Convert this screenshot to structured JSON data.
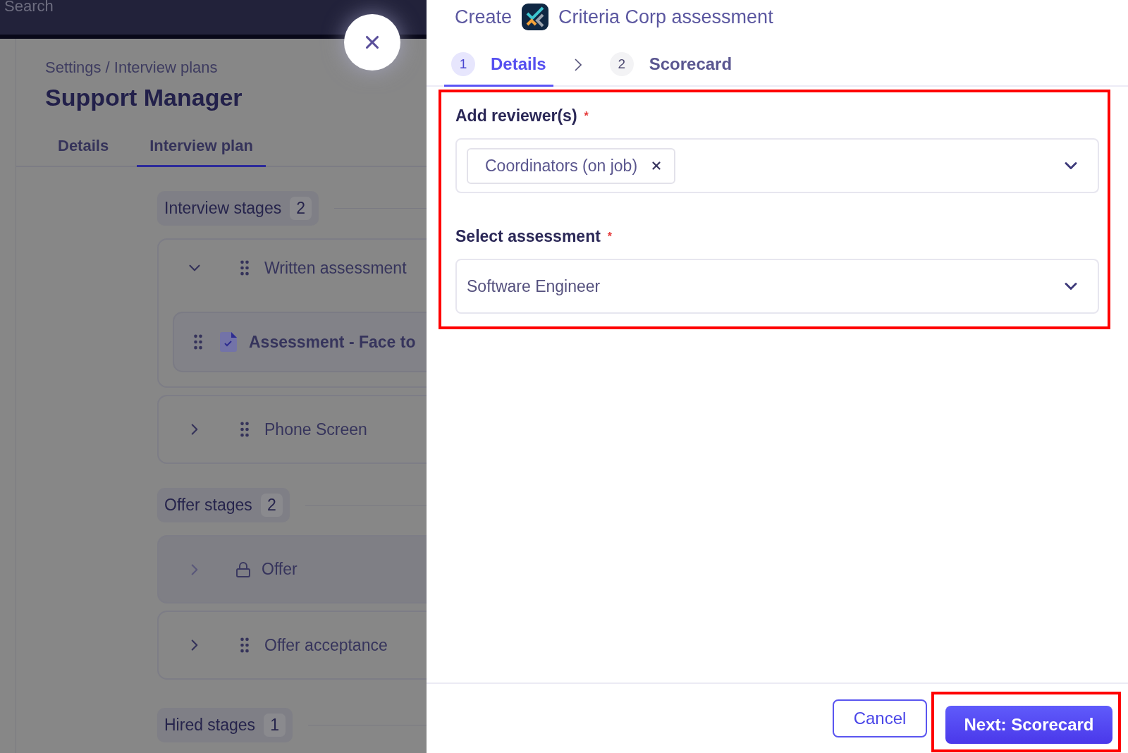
{
  "topbar": {
    "search": "Search"
  },
  "breadcrumb": "Settings / Interview plans",
  "page_title": "Support Manager",
  "page_tabs": [
    {
      "label": "Details",
      "selected": false
    },
    {
      "label": "Interview plan",
      "selected": true
    }
  ],
  "stage_groups": [
    {
      "title": "Interview stages",
      "count": "2",
      "stages": [
        {
          "name": "Written assessment",
          "kind": "drag",
          "expanded": true,
          "children": [
            {
              "name": "Assessment - Face to"
            }
          ]
        },
        {
          "name": "Phone Screen",
          "kind": "drag",
          "expanded": false
        }
      ]
    },
    {
      "title": "Offer stages",
      "count": "2",
      "stages": [
        {
          "name": "Offer",
          "kind": "locked",
          "expanded": false
        },
        {
          "name": "Offer acceptance",
          "kind": "drag",
          "expanded": false
        }
      ]
    },
    {
      "title": "Hired stages",
      "count": "1"
    }
  ],
  "drawer": {
    "title_prefix": "Create",
    "title": "Criteria Corp assessment",
    "steps": [
      {
        "number": "1",
        "label": "Details",
        "selected": true
      },
      {
        "number": "2",
        "label": "Scorecard",
        "selected": false
      }
    ],
    "fields": [
      {
        "label": "Add reviewer(s)",
        "required_mark": "*",
        "kind": "tags",
        "tags": [
          "Coordinators (on job)"
        ]
      },
      {
        "label": "Select assessment",
        "required_mark": "*",
        "kind": "select",
        "value": "Software Engineer"
      }
    ],
    "cancel": "Cancel",
    "next": "Next: Scorecard"
  }
}
